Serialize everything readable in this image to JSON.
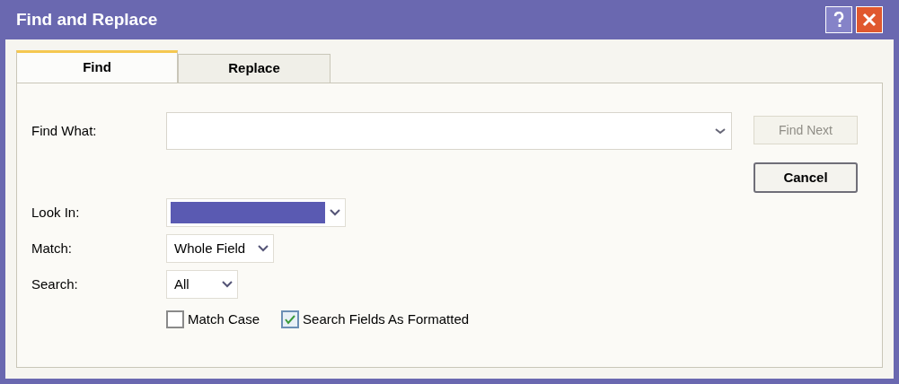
{
  "window": {
    "title": "Find and Replace"
  },
  "tabs": [
    {
      "label": "Find",
      "selected": true
    },
    {
      "label": "Replace",
      "selected": false
    }
  ],
  "find_what": {
    "label": "Find What:"
  },
  "buttons": [
    {
      "label": "Find Next",
      "disabled": true
    },
    {
      "label": "Cancel",
      "disabled": false
    }
  ],
  "options": [
    {
      "label": "Look In:",
      "highlighted": true
    },
    {
      "label": "Match:",
      "value": "Whole Field",
      "highlighted": false
    },
    {
      "label": "Search:",
      "value": "All",
      "highlighted": false
    }
  ],
  "checkboxes": [
    {
      "label": "Match Case",
      "checked": false
    },
    {
      "label": "Search Fields As Formatted",
      "checked": true
    }
  ]
}
